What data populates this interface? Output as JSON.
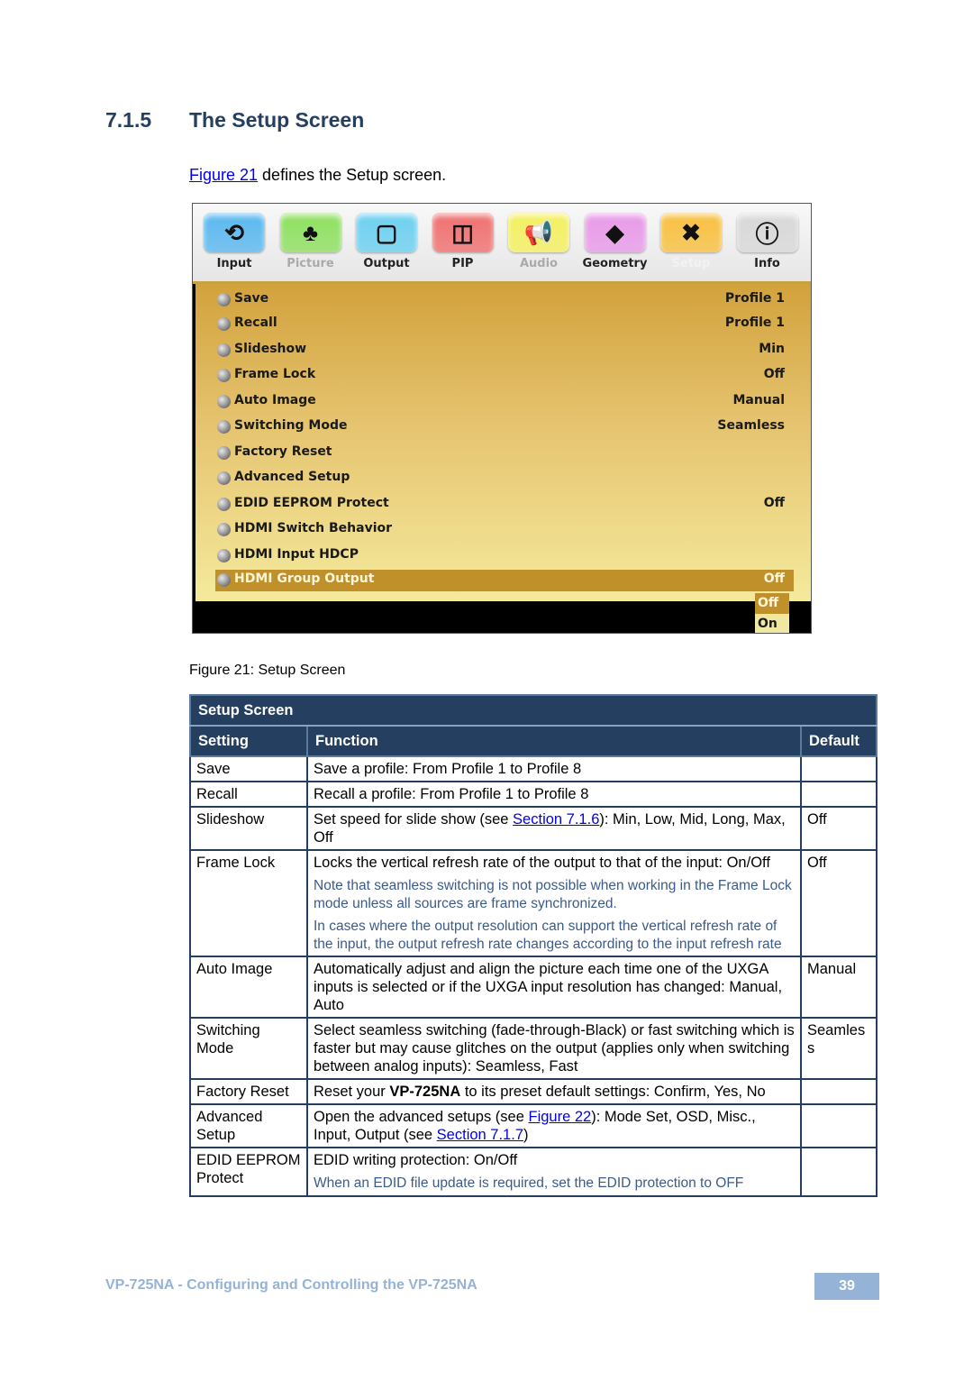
{
  "heading": {
    "number": "7.1.5",
    "title": "The Setup Screen"
  },
  "intro": {
    "link": "Figure 21",
    "text": " defines the Setup screen."
  },
  "osd": {
    "tabs": [
      {
        "label": "Input",
        "icon": "input-cursor-icon",
        "glyph": "⟲",
        "color": "#5ab8f0",
        "state": "normal"
      },
      {
        "label": "Picture",
        "icon": "picture-landscape-icon",
        "glyph": "♣",
        "color": "#8ee060",
        "state": "dim"
      },
      {
        "label": "Output",
        "icon": "monitor-icon",
        "glyph": "▢",
        "color": "#6cd0f0",
        "state": "normal"
      },
      {
        "label": "PIP",
        "icon": "pip-icon",
        "glyph": "◫",
        "color": "#f07070",
        "state": "normal"
      },
      {
        "label": "Audio",
        "icon": "speaker-icon",
        "glyph": "📢",
        "color": "#f4f060",
        "state": "dim"
      },
      {
        "label": "Geometry",
        "icon": "geometry-icon",
        "glyph": "◆",
        "color": "#e89ae8",
        "state": "normal"
      },
      {
        "label": "Setup",
        "icon": "tools-icon",
        "glyph": "✖",
        "color": "#f8c040",
        "state": "selected"
      },
      {
        "label": "Info",
        "icon": "info-icon",
        "glyph": "ⓘ",
        "color": "#d8d8d8",
        "state": "normal"
      }
    ],
    "menu": [
      {
        "label": "Save",
        "value": "Profile 1"
      },
      {
        "label": "Recall",
        "value": "Profile 1"
      },
      {
        "label": "Slideshow",
        "value": "Min"
      },
      {
        "label": "Frame Lock",
        "value": "Off"
      },
      {
        "label": "Auto Image",
        "value": "Manual"
      },
      {
        "label": "Switching Mode",
        "value": "Seamless"
      },
      {
        "label": "Factory Reset",
        "value": ""
      },
      {
        "label": "Advanced Setup",
        "value": ""
      },
      {
        "label": "EDID EEPROM Protect",
        "value": "Off"
      },
      {
        "label": "HDMI Switch Behavior",
        "value": ""
      },
      {
        "label": "HDMI Input HDCP",
        "value": ""
      },
      {
        "label": "HDMI Group Output",
        "value": "Off",
        "selected": true
      }
    ],
    "dropdown": [
      "Off",
      "On"
    ]
  },
  "caption": "Figure 21: Setup Screen",
  "table": {
    "title": "Setup Screen",
    "headers": [
      "Setting",
      "Function",
      "Default"
    ],
    "rows": [
      {
        "setting": "Save",
        "function": "Save a profile: From Profile 1 to Profile 8",
        "default": ""
      },
      {
        "setting": "Recall",
        "function": "Recall a profile: From Profile 1 to Profile 8",
        "default": ""
      },
      {
        "setting": "Slideshow",
        "function_pre": "Set speed for slide show (see ",
        "function_link": "Section 7.1.6",
        "function_post": "): Min, Low, Mid, Long, Max, Off",
        "default": "Off"
      },
      {
        "setting": "Frame Lock",
        "function": "Locks the vertical refresh rate of the output to that of the input: On/Off",
        "notes": [
          "Note that seamless switching is not possible when working in the Frame Lock mode unless all sources are frame synchronized.",
          "In cases where the output resolution can support the vertical refresh rate of the input, the output refresh rate changes according to the input refresh rate"
        ],
        "default": "Off"
      },
      {
        "setting": "Auto Image",
        "function": "Automatically adjust and align the picture each time one of the UXGA inputs is selected or if the UXGA input resolution has changed: Manual, Auto",
        "default": "Manual"
      },
      {
        "setting": "Switching Mode",
        "function": "Select seamless switching (fade-through-Black) or fast switching which is faster but may cause glitches on the output (applies only when switching between analog inputs): Seamless, Fast",
        "default": "Seamless"
      },
      {
        "setting": "Factory Reset",
        "function_pre": "Reset your ",
        "function_bold": "VP-725NA",
        "function_post": " to its preset default settings: Confirm, Yes, No",
        "default": ""
      },
      {
        "setting": "Advanced Setup",
        "function_pre": "Open the advanced setups (see ",
        "function_link": "Figure 22",
        "function_mid": "): Mode Set, OSD, Misc., Input, Output (see ",
        "function_link2": "Section 7.1.7",
        "function_post": ")",
        "default": ""
      },
      {
        "setting": "EDID EEPROM Protect",
        "function": "EDID writing protection: On/Off",
        "notes": [
          "When an EDID file update is required, set the EDID protection to OFF"
        ],
        "default": ""
      }
    ]
  },
  "footer": {
    "text": "VP-725NA - Configuring and Controlling the VP-725NA",
    "page": "39"
  }
}
